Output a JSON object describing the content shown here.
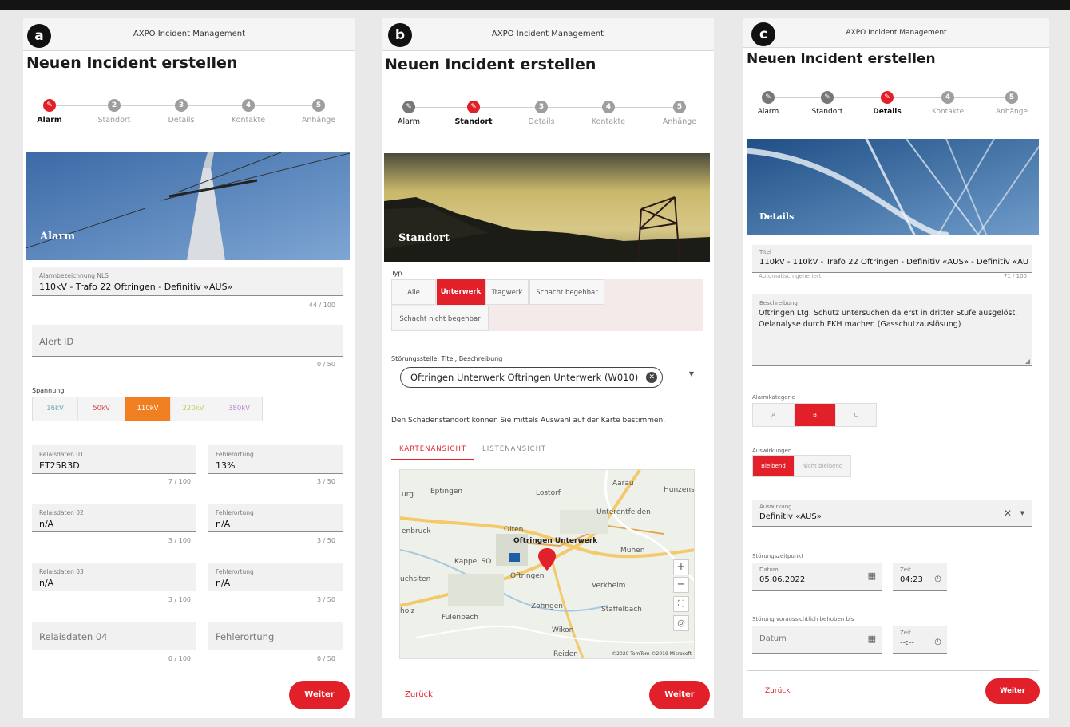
{
  "labels": {
    "a": "a",
    "b": "b",
    "c": "c"
  },
  "app_title": "AXPO Incident Management",
  "page_title": "Neuen Incident erstellen",
  "steps": [
    "Alarm",
    "Standort",
    "Details",
    "Kontakte",
    "Anhänge"
  ],
  "step_numbers": [
    "2",
    "3",
    "4",
    "5"
  ],
  "panel_a": {
    "hero": "Alarm",
    "alarm_label": "Alarmbezeichnung NLS",
    "alarm_value": "110kV - Trafo 22 Oftringen - Definitiv «AUS»",
    "alarm_count": "44 / 100",
    "alert_placeholder": "Alert ID",
    "alert_count": "0 / 50",
    "spannung_label": "Spannung",
    "spannung": [
      "16kV",
      "50kV",
      "110kV",
      "220kV",
      "380kV"
    ],
    "relais_label": "Relaisdaten 01",
    "relais_value": "ET25R3D",
    "relais_count": "7 / 100",
    "fehler_label": "Fehlerortung",
    "fehler_value": "13%",
    "fehler_count": "3 / 50",
    "relais2_label": "Relaisdaten 02",
    "relais2_value": "n/A",
    "relais2_count": "3 / 100",
    "fehler2_label": "Fehlerortung",
    "fehler2_value": "n/A",
    "fehler2_count": "3 / 50",
    "relais3_label": "Relaisdaten 03",
    "relais3_value": "n/A",
    "relais3_count": "3 / 100",
    "fehler3_label": "Fehlerortung",
    "fehler3_value": "n/A",
    "fehler3_count": "3 / 50",
    "relais4_placeholder": "Relaisdaten 04",
    "relais4_count": "0 / 100",
    "fehler4_placeholder": "Fehlerortung",
    "fehler4_count": "0 / 50",
    "weiter": "Weiter"
  },
  "panel_b": {
    "hero": "Standort",
    "typ_label": "Typ",
    "typ": [
      "Alle",
      "Unterwerk",
      "Tragwerk",
      "Schacht begehbar",
      "Schacht nicht begehbar"
    ],
    "stoerung_label": "Störungsstelle, Titel, Beschreibung",
    "stoerung_value": "Oftringen Unterwerk Oftringen Unterwerk (W010)",
    "hint": "Den Schadenstandort können Sie mittels Auswahl auf der Karte bestimmen.",
    "tabs": [
      "KARTENANSICHT",
      "LISTENANSICHT"
    ],
    "map_places": [
      "Eptingen",
      "Lostorf",
      "Aarau",
      "Hunzens",
      "Unterentfelden",
      "Olten",
      "Oftringen Unterwerk",
      "Kappel SO",
      "Oftringen",
      "Muhen",
      "uchsiten",
      "Verkheim",
      "Zofingen",
      "Staffelbach",
      "Fulenbach",
      "Wikon",
      "Reiden",
      "holz",
      "enbruck",
      "urg"
    ],
    "map_copyright": "©2020 TomTom ©2019 Microsoft",
    "zurueck": "Zurück",
    "weiter": "Weiter"
  },
  "panel_c": {
    "hero": "Details",
    "titel_label": "Titel",
    "titel_value": "110kV - 110kV - Trafo 22 Oftringen - Definitiv «AUS» - Definitiv «AU",
    "auto_hint": "Automatisch generiert",
    "titel_count": "71 / 100",
    "beschreibung_label": "Beschreibung",
    "beschreibung_value": "Oftringen Ltg. Schutz untersuchen da erst in dritter Stufe ausgelöst. Oelanalyse durch FKH machen (Gasschutzauslösung)",
    "kategorie_label": "Alarmkategorie",
    "kategorie": [
      "A",
      "B",
      "C"
    ],
    "auswirkungen_label": "Auswirkungen",
    "auswirkungen": [
      "Bleibend",
      "Nicht bleibend"
    ],
    "auswirkung_label": "Auswirkung",
    "auswirkung_value": "Definitiv «AUS»",
    "zeitpunkt_label": "Störungszeitpunkt",
    "datum_label": "Datum",
    "datum_value": "05.06.2022",
    "zeit_label": "Zeit",
    "zeit_value": "04:23",
    "behoben_label": "Störung voraussichtlich behoben bis",
    "datum2_placeholder": "Datum",
    "zeit2_label": "Zeit",
    "zeit2_value": "--:--",
    "zurueck": "Zurück",
    "weiter": "Weiter"
  },
  "colors": {
    "accent": "#e2202a",
    "orange": "#f07f22"
  }
}
